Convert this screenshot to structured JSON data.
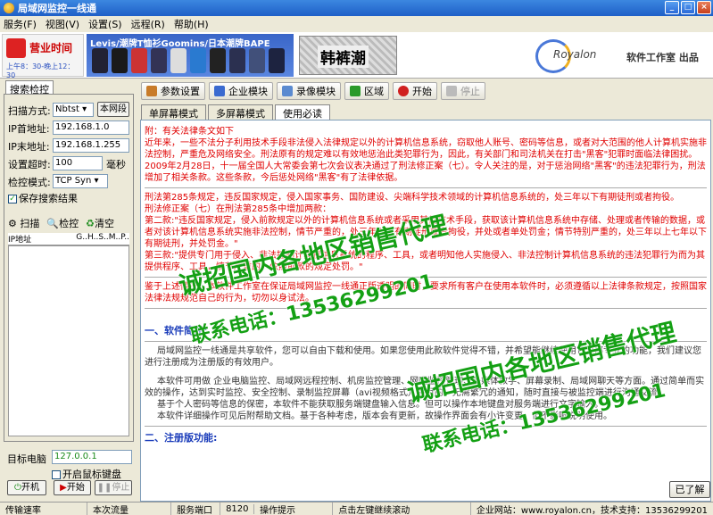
{
  "window": {
    "title": "局域网监控一线通"
  },
  "menu": [
    "服务(F)",
    "视图(V)",
    "设置(S)",
    "远程(R)",
    "帮助(H)"
  ],
  "banner": {
    "business_hours": "营业时间",
    "business_hours_sub": "上午8：30-晚上12：30",
    "ad_text": "Levis/潮牌T恤衫Goomins/日本潮牌BAPE",
    "shop_text": "韩裤潮",
    "logo_text": "Royalon",
    "brand": "软件工作室 出品"
  },
  "left": {
    "tab_label": "搜索检控",
    "scan_mode_label": "扫描方式:",
    "scan_mode_value": "Nbtst",
    "local_net_button": "本网段",
    "ip_start_label": "IP首地址:",
    "ip_start": "192.168.1.0",
    "ip_end_label": "IP末地址:",
    "ip_end": "192.168.1.255",
    "timeout_label": "设置超时:",
    "timeout_value": "100",
    "timeout_unit": "毫秒",
    "check_mode_label": "检控模式:",
    "check_mode_value": "TCP Syn",
    "save_results_label": "保存搜索结果",
    "scan_button": "扫描",
    "check_button": "检控",
    "clear_button": "清空",
    "list_header_ip": "IP地址",
    "list_header_cols": "G..H..S..M..P..",
    "target_label": "目标电脑",
    "target_value": "127.0.0.1",
    "open_mouse_label": "开启鼠标键盘",
    "power_on_button": "开机",
    "start_button": "开始",
    "stop_button": "停止"
  },
  "toolbar": {
    "params_button": "参数设置",
    "enterprise_button": "企业模块",
    "record_button": "录像模块",
    "zone_button": "区域",
    "start_button": "开始",
    "stop_button": "停止"
  },
  "tabs": [
    "单屏幕模式",
    "多屏幕模式",
    "使用必读"
  ],
  "content": {
    "law_title": "附：有关法律条文如下",
    "law_p1": "近年来，一些不法分子利用技术手段非法侵入法律规定以外的计算机信息系统，窃取他人账号、密码等信息，或者对大范围的他人计算机实施非法控制，严重危及网络安全。刑法原有的规定难以有效地惩治此类犯罪行为，因此，有关部门和司法机关在打击\"黑客\"犯罪时面临法律困扰。",
    "law_p2": "2009年2月28日，十一届全国人大常委会第七次会议表决通过了刑法修正案（七）。令人关注的是，对于惩治网络\"黑客\"的违法犯罪行为，刑法增加了相关条款。这些条款，今后惩处网络\"黑客\"有了法律依据。",
    "law_p3": "刑法第285条规定，违反国家规定，侵入国家事务、国防建设、尖端科学技术领域的计算机信息系统的，处三年以下有期徒刑或者拘役。",
    "law_p4": "刑法修正案（七）在刑法第285条中增加两款：",
    "law_p5": "第二款:\"违反国家规定，侵入前款规定以外的计算机信息系统或者采用其他技术手段，获取该计算机信息系统中存储、处理或者传输的数据，或者对该计算机信息系统实施非法控制，情节严重的，处三年以下有期徒刑或者拘役，并处或者单处罚金；情节特别严重的，处三年以上七年以下有期徒刑，并处罚金。\"",
    "law_p6": "第三款:\"提供专门用于侵入、非法控制计算机信息系统的程序、工具，或者明知他人实施侵入、非法控制计算机信息系统的违法犯罪行为而为其提供程序、工具，情节严重的，依照前款的规定处罚。\"",
    "law_p7": "鉴于上述情况，本软件工作室在保证局域网监控一线通正版透明的同时，要求所有客户在使用本软件时，必须遵循以上法律条款规定，按照国家法律法规规范自己的行为，切勿以身试法。",
    "section1_title": "一、软件简述:",
    "intro_p1": "局域网监控一线通是共享软件，您可以自由下载和使用。如果您使用此款软件觉得不错，并希望能继续使用它全部专业的功能，我们建议您进行注册成为注册版的有效用户。",
    "intro_p2": "本软件可用做 企业电脑监控、局域网远程控制、机房监控管理、网吧监控管理、多媒体教学、屏幕录制、局域网聊天等方面。通过简单而实效的操作，达到实时监控、安全控制、录制监控屏幕（avi视频格式）等目的。无需繁冗的通知，随时直接与被监控端进行沟通交流。",
    "intro_p3": "基于个人密码等信息的保密，本软件不能获取服务端键盘输入信息。但可以操作本地键盘对服务端进行文字输入。",
    "intro_p4": "本软件详细操作可见后附帮助文档。基于各种考虑，版本会有更新，故操作界面会有小许变更，但不影响说明使用。",
    "section2_title": "二、注册版功能:",
    "close_button": "已了解"
  },
  "watermark": {
    "line1": "诚招国内各地区销售代理",
    "line2": "联系电话：13536299201"
  },
  "status": {
    "rate": "传输速率",
    "flow": "本次流量",
    "port_label": "服务端口",
    "port": "8120",
    "hint_label": "操作提示",
    "hint": "点击左键继续滚动",
    "site": "企业网站：www.royalon.cn，技术支持：13536299201"
  },
  "colors": {
    "title_blue": "#1e5fc7",
    "law_red": "#e00000",
    "section_blue": "#1a3cba",
    "watermark_green": "#14a014"
  }
}
